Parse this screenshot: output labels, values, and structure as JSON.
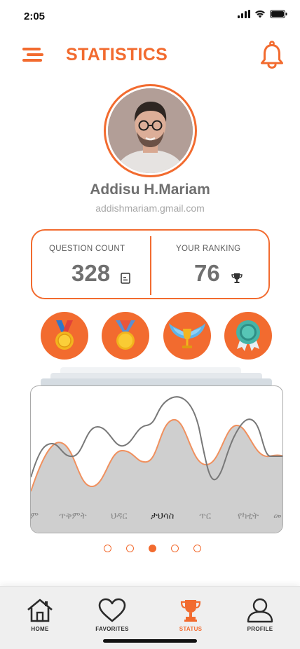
{
  "status_bar": {
    "time": "2:05"
  },
  "header": {
    "title": "STATISTICS"
  },
  "profile": {
    "name": "Addisu H.Mariam",
    "email": "addishmariam.gmail.com"
  },
  "stats": {
    "question_count_label": "QUESTION COUNT",
    "question_count_value": "328",
    "ranking_label": "YOUR RANKING",
    "ranking_value": "76"
  },
  "badges": [
    "gold-medal-icon",
    "gold-medal-ribbon-icon",
    "winged-trophy-icon",
    "rosette-award-icon"
  ],
  "chart": {
    "days": [
      "ም",
      "ጥቅምት",
      "ህዳር",
      "ታህሳስ",
      "ጥር",
      "የካቲት",
      "መ"
    ],
    "active_day": "ታህሳስ",
    "colors": {
      "line_orange": "#f0905e",
      "line_gray": "#787878",
      "fill": "#cfcfcf"
    }
  },
  "pagination": {
    "count": 5,
    "active_index": 2
  },
  "bottom_nav": {
    "items": [
      {
        "label": "HOME"
      },
      {
        "label": "FAVORITES"
      },
      {
        "label": "STATUS"
      },
      {
        "label": "PROFILE"
      }
    ],
    "active_index": 2
  },
  "colors": {
    "accent": "#f26b2f"
  }
}
